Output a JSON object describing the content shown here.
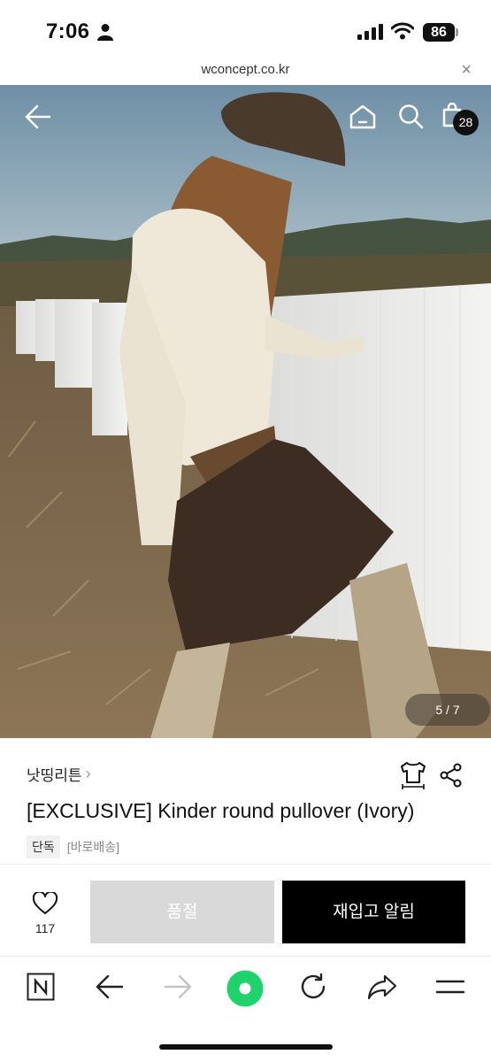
{
  "status_bar": {
    "time": "7:06",
    "battery": "86"
  },
  "url_bar": {
    "url": "wconcept.co.kr",
    "close_symbol": "×"
  },
  "hero": {
    "cart_count": "28",
    "image_counter": "5 / 7"
  },
  "product": {
    "brand": "낫띵리튼",
    "brand_chevron": "›",
    "title": "[EXCLUSIVE] Kinder round pullover (Ivory)",
    "tag_exclusive": "단독",
    "tag_delivery": "[바로배송]"
  },
  "actions": {
    "like_count": "117",
    "soldout_label": "품절",
    "restock_label": "재입고 알림"
  },
  "colors": {
    "accent_green": "#1ed36b",
    "sold_out_gray": "#d9d9d9",
    "primary_black": "#000000"
  }
}
